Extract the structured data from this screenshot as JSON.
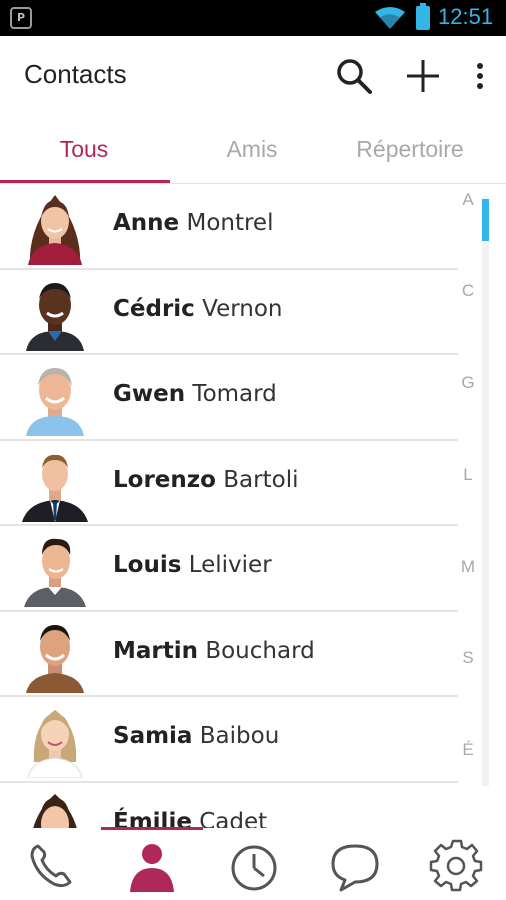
{
  "status_bar": {
    "app_icon_label": "P",
    "time": "12:51",
    "colors": {
      "accent": "#33b5e5",
      "background": "#000000"
    }
  },
  "action_bar": {
    "title": "Contacts",
    "icons": [
      "search-icon",
      "add-icon",
      "overflow-menu-icon"
    ]
  },
  "tabs": [
    {
      "label": "Tous",
      "active": true
    },
    {
      "label": "Amis",
      "active": false
    },
    {
      "label": "Répertoire",
      "active": false
    }
  ],
  "contacts": [
    {
      "first": "Anne",
      "last": "Montrel"
    },
    {
      "first": "Cédric",
      "last": "Vernon"
    },
    {
      "first": "Gwen",
      "last": "Tomard"
    },
    {
      "first": "Lorenzo",
      "last": "Bartoli"
    },
    {
      "first": "Louis",
      "last": "Lelivier"
    },
    {
      "first": "Martin",
      "last": "Bouchard"
    },
    {
      "first": "Samia",
      "last": "Baibou"
    },
    {
      "first": "Émilie",
      "last": "Cadet"
    }
  ],
  "alpha_index": [
    "A",
    "C",
    "G",
    "L",
    "M",
    "S",
    "É"
  ],
  "bottom_nav": [
    {
      "icon": "phone-icon",
      "active": false
    },
    {
      "icon": "contacts-icon",
      "active": true
    },
    {
      "icon": "clock-icon",
      "active": false
    },
    {
      "icon": "chat-icon",
      "active": false
    },
    {
      "icon": "settings-gear-icon",
      "active": false
    }
  ],
  "colors": {
    "primary": "#b0285a",
    "tab_inactive": "#a9a9a9",
    "divider": "#e4e4e4",
    "scroll_thumb": "#33b5e5",
    "icon_gray": "#555555"
  }
}
